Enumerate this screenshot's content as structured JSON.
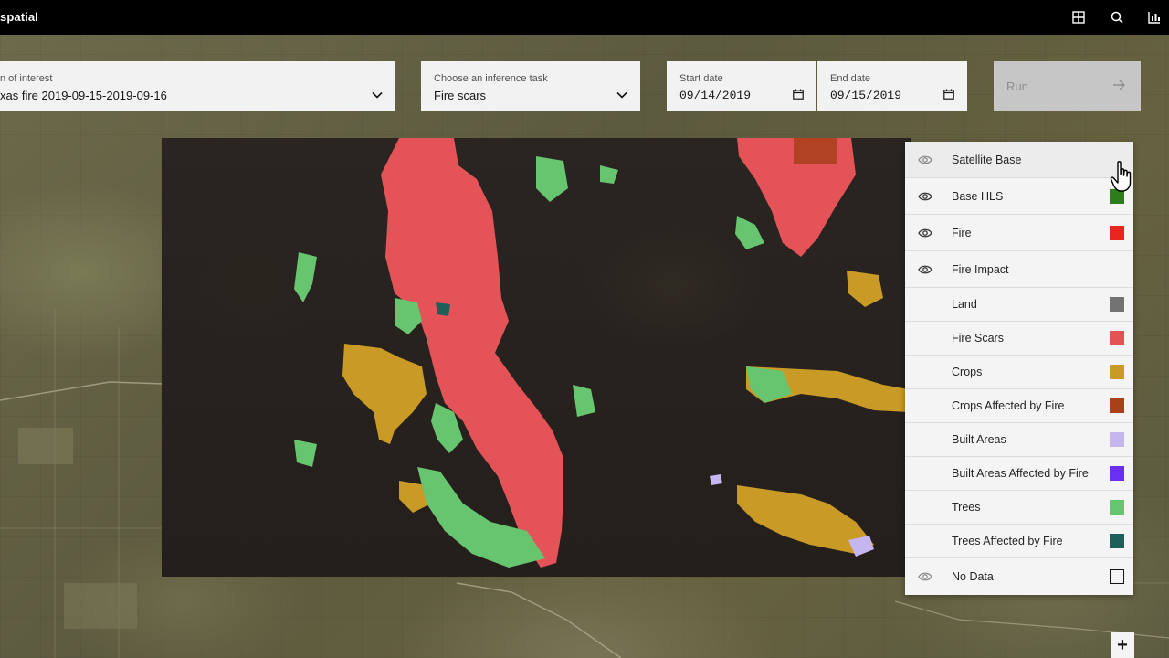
{
  "header": {
    "brand": "spatial",
    "icons": [
      "grid-icon",
      "search-icon",
      "dashboard-icon"
    ]
  },
  "form": {
    "area_of_interest": {
      "label": "n of interest",
      "value": "xas fire 2019-09-15-2019-09-16"
    },
    "inference_task": {
      "label": "Choose an inference task",
      "value": "Fire scars"
    },
    "start_date": {
      "label": "Start date",
      "value": "09/14/2019"
    },
    "end_date": {
      "label": "End date",
      "value": "09/15/2019"
    },
    "run_label": "Run"
  },
  "legend": {
    "items": [
      {
        "label": "Satellite Base",
        "eye": true,
        "swatch": null
      },
      {
        "label": "Base HLS",
        "eye": true,
        "swatch": "#2e7d1d"
      },
      {
        "label": "Fire",
        "eye": true,
        "swatch": "#e8251f"
      },
      {
        "label": "Fire Impact",
        "eye": true,
        "swatch": null
      },
      {
        "label": "Land",
        "eye": false,
        "swatch": "#737373"
      },
      {
        "label": "Fire Scars",
        "eye": false,
        "swatch": "#e35353"
      },
      {
        "label": "Crops",
        "eye": false,
        "swatch": "#c99a26"
      },
      {
        "label": "Crops Affected by Fire",
        "eye": false,
        "swatch": "#a8401a"
      },
      {
        "label": "Built Areas",
        "eye": false,
        "swatch": "#c6b6f0"
      },
      {
        "label": "Built Areas Affected by Fire",
        "eye": false,
        "swatch": "#6a2ff0"
      },
      {
        "label": "Trees",
        "eye": false,
        "swatch": "#67c46f"
      },
      {
        "label": "Trees Affected by Fire",
        "eye": false,
        "swatch": "#1f5f5a"
      },
      {
        "label": "No Data",
        "eye": true,
        "swatch": "outline"
      }
    ]
  },
  "zoom": {
    "plus_label": "+"
  },
  "colors": {
    "fire_scar": "#e35358",
    "crops": "#c99a26",
    "trees": "#67c46f"
  }
}
